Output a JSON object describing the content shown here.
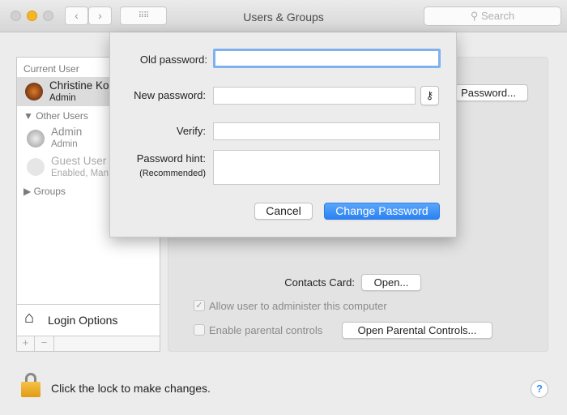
{
  "window": {
    "title": "Users & Groups",
    "search_placeholder": "Search"
  },
  "sidebar": {
    "current_user_header": "Current User",
    "current_user": {
      "name": "Christine Ko",
      "role": "Admin"
    },
    "other_users_header": "Other Users",
    "other_users": [
      {
        "name": "Admin",
        "role": "Admin"
      },
      {
        "name": "Guest User",
        "role": "Enabled, Man"
      }
    ],
    "groups": "Groups",
    "login_options": "Login Options",
    "add": "+",
    "remove": "−"
  },
  "main": {
    "change_password_button": "Password...",
    "contacts_card_label": "Contacts Card:",
    "open_button": "Open...",
    "allow_admin": {
      "label": "Allow user to administer this computer",
      "checked": true
    },
    "parental": {
      "label": "Enable parental controls",
      "checked": false
    },
    "open_parental_button": "Open Parental Controls..."
  },
  "sheet": {
    "old_password_label": "Old password:",
    "old_password_value": "",
    "new_password_label": "New password:",
    "new_password_value": "",
    "verify_label": "Verify:",
    "verify_value": "",
    "hint_label": "Password hint:",
    "hint_sub": "(Recommended)",
    "hint_value": "",
    "cancel": "Cancel",
    "change": "Change Password"
  },
  "footer": {
    "lock_text": "Click the lock to make changes.",
    "help": "?"
  },
  "colors": {
    "accent": "#3b8ff5",
    "focus": "#7fb1ee"
  }
}
